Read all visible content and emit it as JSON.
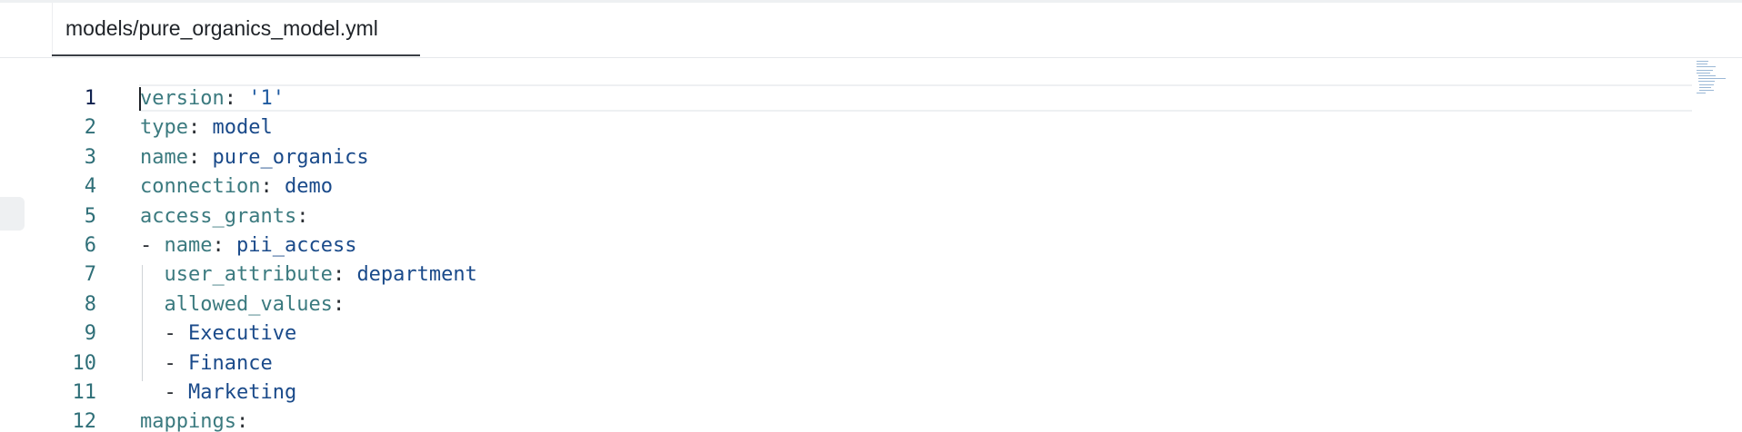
{
  "tab": {
    "label": "models/pure_organics_model.yml"
  },
  "editor": {
    "active_line": 1,
    "lines": [
      {
        "n": "1",
        "indent": "",
        "dash": "",
        "key": "version",
        "colon": ":",
        "value": "'1'",
        "value_kind": "str"
      },
      {
        "n": "2",
        "indent": "",
        "dash": "",
        "key": "type",
        "colon": ":",
        "value": "model",
        "value_kind": "val"
      },
      {
        "n": "3",
        "indent": "",
        "dash": "",
        "key": "name",
        "colon": ":",
        "value": "pure_organics",
        "value_kind": "val"
      },
      {
        "n": "4",
        "indent": "",
        "dash": "",
        "key": "connection",
        "colon": ":",
        "value": "demo",
        "value_kind": "val"
      },
      {
        "n": "5",
        "indent": "",
        "dash": "",
        "key": "access_grants",
        "colon": ":",
        "value": "",
        "value_kind": "val"
      },
      {
        "n": "6",
        "indent": "",
        "dash": "- ",
        "key": "name",
        "colon": ":",
        "value": "pii_access",
        "value_kind": "val"
      },
      {
        "n": "7",
        "indent": "  ",
        "dash": "",
        "key": "user_attribute",
        "colon": ":",
        "value": "department",
        "value_kind": "val"
      },
      {
        "n": "8",
        "indent": "  ",
        "dash": "",
        "key": "allowed_values",
        "colon": ":",
        "value": "",
        "value_kind": "val"
      },
      {
        "n": "9",
        "indent": "  ",
        "dash": "- ",
        "key": "",
        "colon": "",
        "value": "Executive",
        "value_kind": "val"
      },
      {
        "n": "10",
        "indent": "  ",
        "dash": "- ",
        "key": "",
        "colon": "",
        "value": "Finance",
        "value_kind": "val"
      },
      {
        "n": "11",
        "indent": "  ",
        "dash": "- ",
        "key": "",
        "colon": "",
        "value": "Marketing",
        "value_kind": "val"
      },
      {
        "n": "12",
        "indent": "",
        "dash": "",
        "key": "mappings",
        "colon": ":",
        "value": "",
        "value_kind": "val"
      }
    ]
  },
  "colors": {
    "key": "#3b7a7f",
    "value": "#1a4a8a",
    "line_number": "#2f6f78",
    "active_line_number": "#0d1f4d"
  }
}
